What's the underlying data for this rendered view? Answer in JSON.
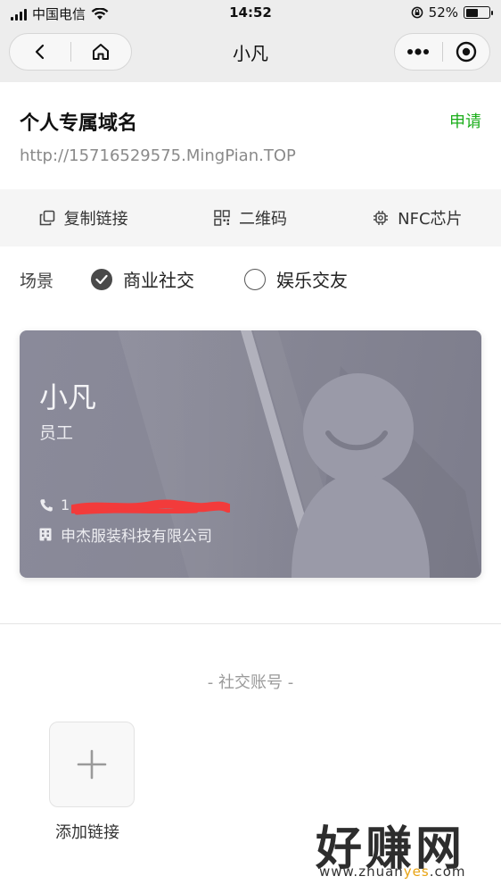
{
  "status_bar": {
    "carrier": "中国电信",
    "time": "14:52",
    "battery_percent": "52%",
    "battery_level": 0.52
  },
  "nav": {
    "title": "小凡",
    "back_icon": "chevron-left-icon",
    "home_icon": "home-icon",
    "more_icon": "more-dots-icon",
    "close_icon": "target-close-icon"
  },
  "domain": {
    "title": "个人专属域名",
    "apply_label": "申请",
    "url": "http://15716529575.MingPian.TOP",
    "accent_color": "#1aad19"
  },
  "actions": [
    {
      "label": "复制链接",
      "icon": "copy-icon"
    },
    {
      "label": "二维码",
      "icon": "qrcode-icon"
    },
    {
      "label": "NFC芯片",
      "icon": "chip-icon"
    }
  ],
  "scene": {
    "label": "场景",
    "options": [
      {
        "label": "商业社交",
        "checked": true
      },
      {
        "label": "娱乐交友",
        "checked": false
      }
    ]
  },
  "card": {
    "name": "小凡",
    "role": "员工",
    "phone": "1",
    "company": "申杰服装科技有限公司"
  },
  "social": {
    "title": "- 社交账号 -",
    "add_label": "添加链接"
  },
  "watermark": {
    "big": "好赚网",
    "small_prefix": "www.zhuan",
    "small_accent": "yes",
    "small_suffix": ".com"
  }
}
